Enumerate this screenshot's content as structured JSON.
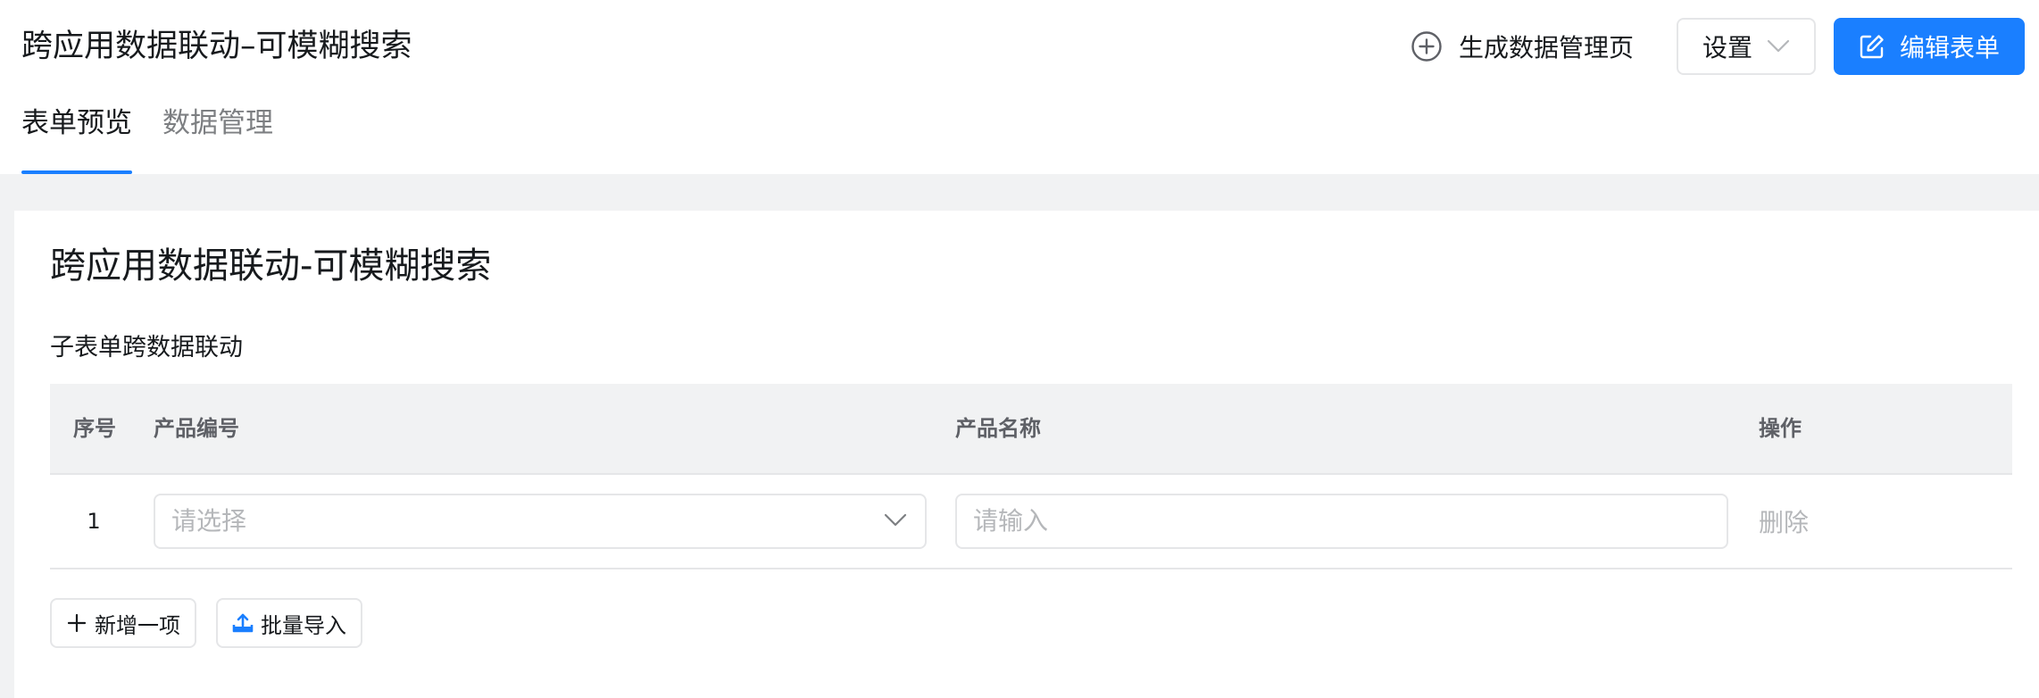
{
  "header": {
    "app_title": "跨应用数据联动–可模糊搜索",
    "generate_page_label": "生成数据管理页",
    "settings_label": "设置",
    "edit_form_label": "编辑表单"
  },
  "tabs": [
    {
      "label": "表单预览",
      "active": true
    },
    {
      "label": "数据管理",
      "active": false
    }
  ],
  "form": {
    "title": "跨应用数据联动-可模糊搜索",
    "subform_label": "子表单跨数据联动",
    "table": {
      "headers": [
        "序号",
        "产品编号",
        "产品名称",
        "操作"
      ],
      "rows": [
        {
          "index": "1",
          "product_code_placeholder": "请选择",
          "product_name_placeholder": "请输入",
          "action": "删除"
        }
      ]
    },
    "add_item_label": "新增一项",
    "batch_import_label": "批量导入"
  },
  "colors": {
    "primary": "#1a7fff",
    "text": "#171a1d",
    "muted": "#7d7f82",
    "placeholder": "#b5b7ba",
    "border": "#e5e6e8",
    "page_bg": "#f1f2f3"
  },
  "icons": {
    "generate": "plus-circle-icon",
    "settings": "chevron-down-icon",
    "edit": "edit-icon",
    "add": "plus-icon",
    "import": "upload-icon"
  }
}
